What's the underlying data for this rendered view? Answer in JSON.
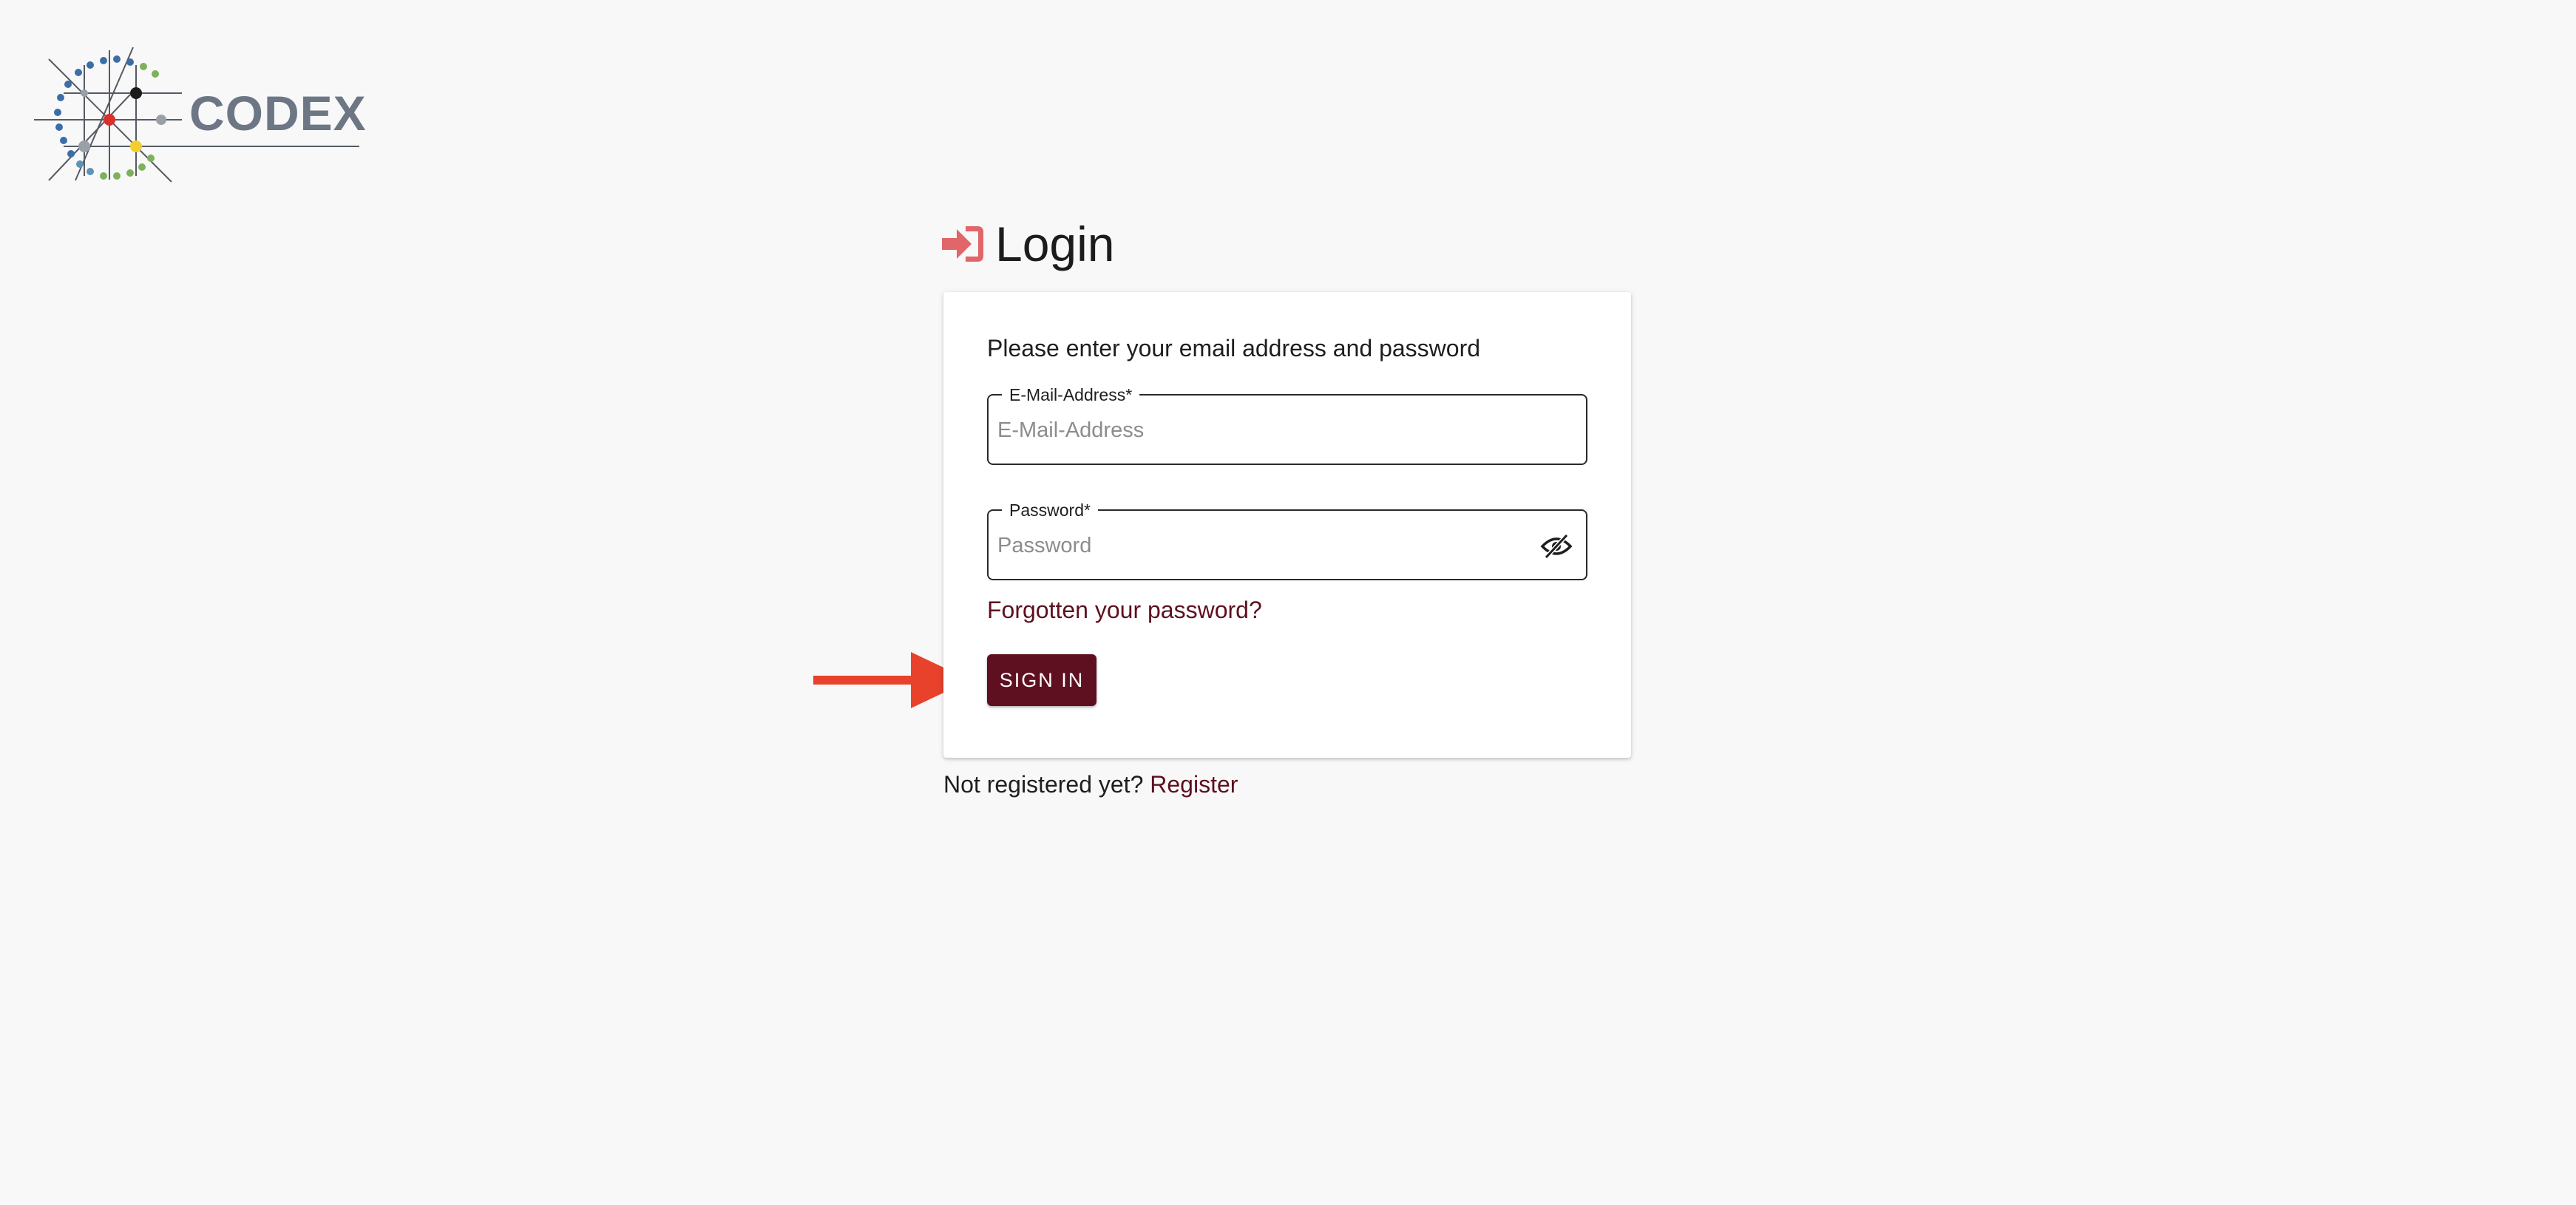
{
  "logo": {
    "text": "CODEX",
    "icon": "codex-network-logo-icon"
  },
  "heading": {
    "icon": "login-icon",
    "title": "Login"
  },
  "form": {
    "intro": "Please enter your email address and password",
    "email": {
      "label": "E-Mail-Address*",
      "placeholder": "E-Mail-Address",
      "value": ""
    },
    "password": {
      "label": "Password*",
      "placeholder": "Password",
      "value": "",
      "toggle_icon": "eye-slash-icon"
    },
    "forgot_link": "Forgotten your password?",
    "signin_label": "SIGN IN"
  },
  "register": {
    "prompt": "Not registered yet?",
    "link": "Register"
  },
  "annotation": {
    "icon": "red-arrow-right-icon"
  },
  "colors": {
    "background": "#f8f8f8",
    "brand": "#5e1020",
    "login_icon": "#e0666a",
    "annotation_arrow": "#e8412c",
    "logo_text": "#6d7684"
  }
}
